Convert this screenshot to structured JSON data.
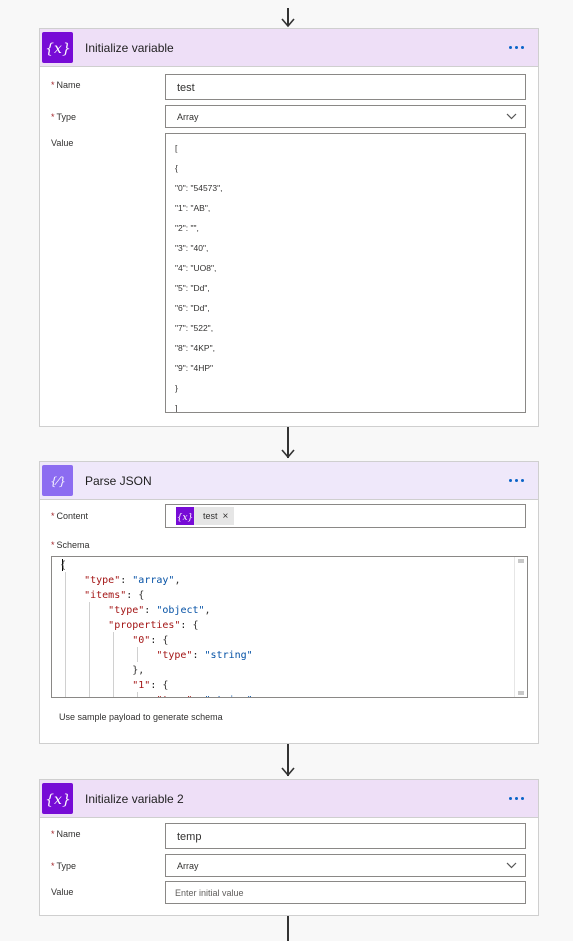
{
  "steps": [
    {
      "title": "Initialize variable",
      "name_label": "Name",
      "name_value": "test",
      "type_label": "Type",
      "type_value": "Array",
      "value_label": "Value",
      "value_lines": [
        "[",
        "{",
        "\"0\": \"54573\",",
        "\"1\": \"AB\",",
        "\"2\": \"\",",
        "\"3\": \"40\",",
        "\"4\": \"UO8\",",
        "\"5\": \"Dd\",",
        "\"6\": \"Dd\",",
        "\"7\": \"522\",",
        "\"8\": \"4KP\",",
        "\"9\": \"4HP\"",
        "}",
        "]"
      ]
    },
    {
      "title": "Parse JSON",
      "content_label": "Content",
      "content_token": "test",
      "content_token_close": "×",
      "schema_label": "Schema",
      "schema_lines": [
        "{",
        "    \"type\": \"array\",",
        "    \"items\": {",
        "        \"type\": \"object\",",
        "        \"properties\": {",
        "            \"0\": {",
        "                \"type\": \"string\"",
        "            },",
        "            \"1\": {",
        "                \"type\": \"string\""
      ],
      "sample_link": "Use sample payload to generate schema"
    },
    {
      "title": "Initialize variable 2",
      "name_label": "Name",
      "name_value": "temp",
      "type_label": "Type",
      "type_value": "Array",
      "value_label": "Value",
      "value_placeholder": "Enter initial value"
    }
  ],
  "required_mark": "*",
  "icons": {
    "variable": "variable-brace-icon",
    "parse": "parse-json-icon",
    "menu": "more-dots-icon",
    "arrow": "down-arrow-icon",
    "chevron": "chevron-down-icon"
  },
  "colors": {
    "variable_header": "#eedff7",
    "variable_icon": "#770bd6",
    "parse_header": "#efe8fa",
    "parse_icon": "#8c6cf1",
    "link": "#0a64c8",
    "required": "#a4262c"
  }
}
